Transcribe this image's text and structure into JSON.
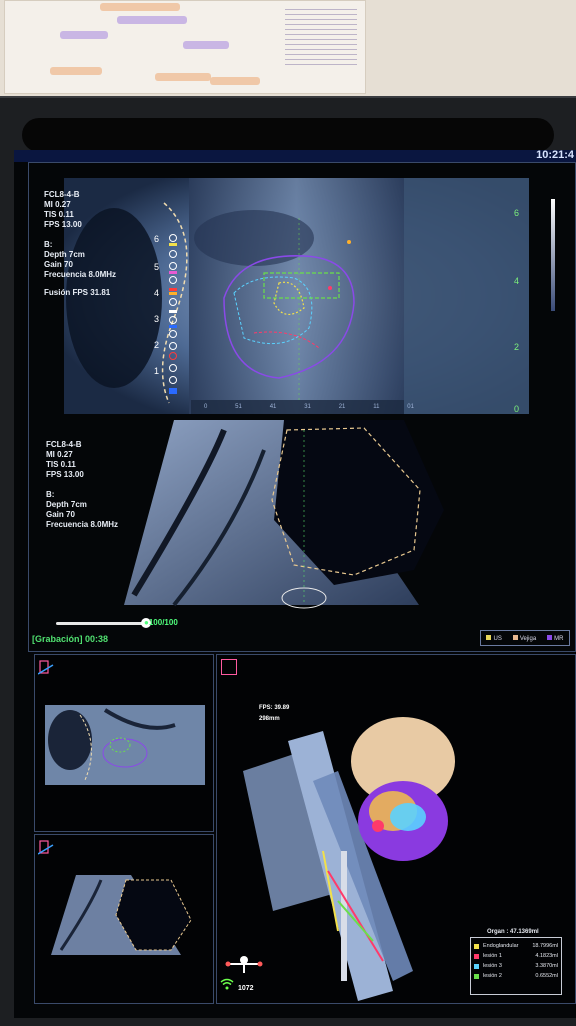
{
  "monitor": {
    "clock": "10:21:4"
  },
  "top_overlay": {
    "probe": "FCL8-4-B",
    "mi": "MI 0.27",
    "tis": "TIS 0.11",
    "fps": "FPS 13.00",
    "mode": "B:",
    "depth": "Depth 7cm",
    "gain": "Gain 70",
    "freq": "Frecuencia 8.0MHz",
    "fusion_fps": "Fusión FPS 31.81"
  },
  "bottom_overlay": {
    "probe": "FCL8-4-B",
    "mi": "MI 0.27",
    "tis": "TIS 0.11",
    "fps": "FPS 13.00",
    "mode": "B:",
    "depth": "Depth 7cm",
    "gain": "Gain 70",
    "freq": "Frecuencia 8.0MHz"
  },
  "depth_scale": [
    "6",
    "4",
    "2",
    "0"
  ],
  "channel_numbers": [
    "6",
    "5",
    "4",
    "3",
    "2",
    "1"
  ],
  "bottom_ruler": [
    "0",
    "51",
    "41",
    "31",
    "21",
    "11",
    "01"
  ],
  "recording": {
    "label": "[Grabación] 00:38",
    "playback": "100/100"
  },
  "legend": {
    "items": [
      {
        "label": "US",
        "color": "#e8d65a"
      },
      {
        "label": "Vejiga",
        "color": "#e8b890"
      },
      {
        "label": "MR",
        "color": "#8a4ae8"
      }
    ]
  },
  "render3d": {
    "fps": "FPS: 39.89",
    "size": "298mm",
    "organ": "Organ : 47.1369ml",
    "volumes": [
      {
        "name": "Endoglandular",
        "value": "18.7996ml",
        "color": "#f2e04a"
      },
      {
        "name": "lesión 1",
        "value": "4.1823ml",
        "color": "#ff3a6a"
      },
      {
        "name": "lesión 3",
        "value": "3.3870ml",
        "color": "#5ad2ff"
      },
      {
        "name": "lesión 2",
        "value": "0.6552ml",
        "color": "#6adf4a"
      }
    ],
    "connection_count": "1072"
  },
  "icons": [
    "clock-icon",
    "cube-3d-icon",
    "probe-icon",
    "wifi-icon",
    "body-orientation-icon"
  ]
}
